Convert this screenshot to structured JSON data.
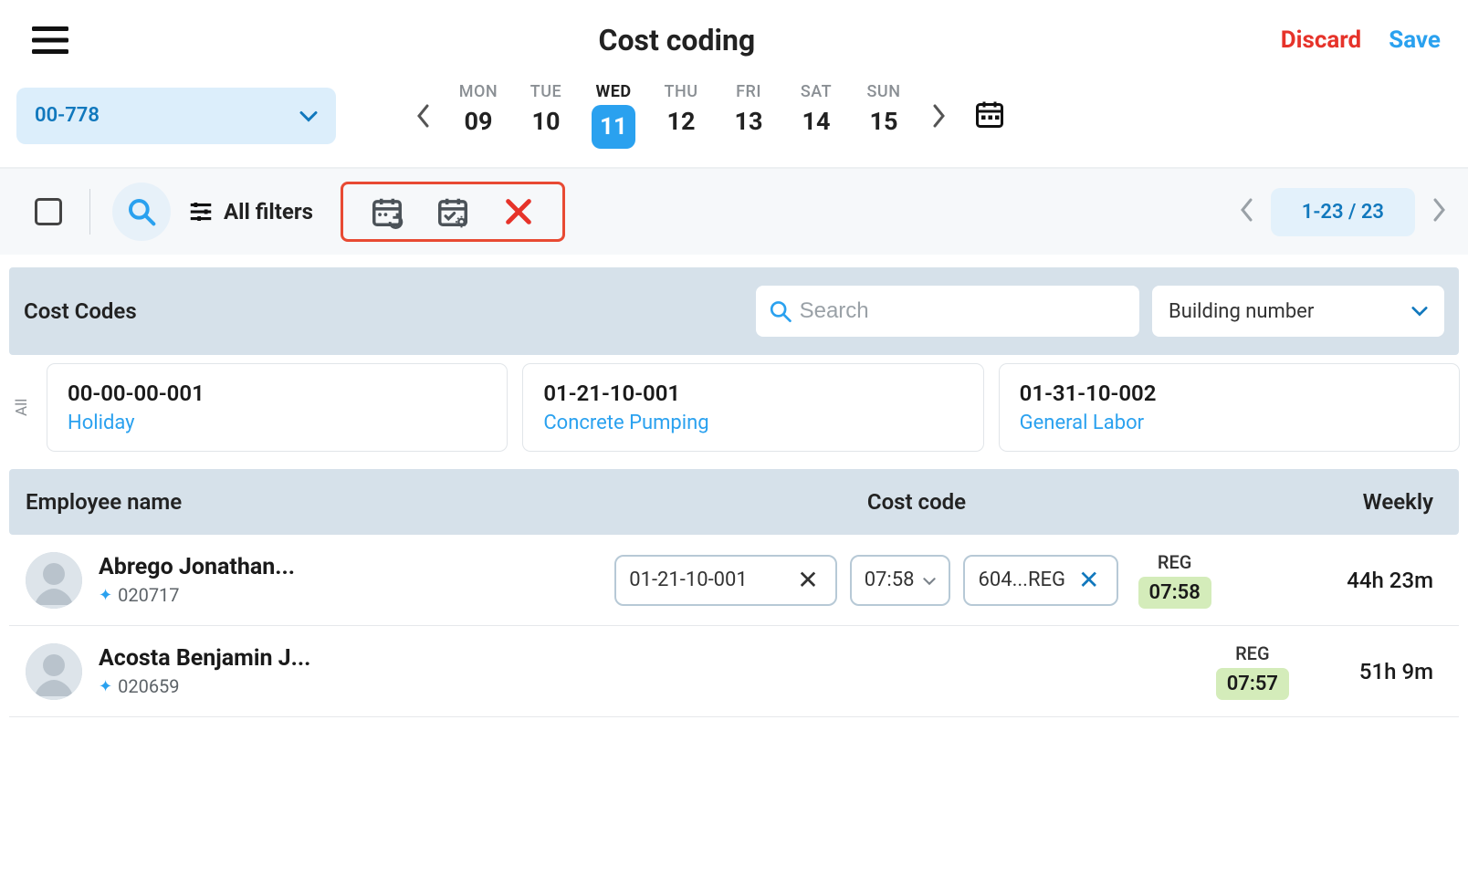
{
  "header": {
    "title": "Cost coding",
    "discard": "Discard",
    "save": "Save"
  },
  "project": {
    "code": "00-778"
  },
  "week": {
    "days": [
      {
        "label": "MON",
        "num": "09"
      },
      {
        "label": "TUE",
        "num": "10"
      },
      {
        "label": "WED",
        "num": "11",
        "selected": true
      },
      {
        "label": "THU",
        "num": "12"
      },
      {
        "label": "FRI",
        "num": "13"
      },
      {
        "label": "SAT",
        "num": "14"
      },
      {
        "label": "SUN",
        "num": "15"
      }
    ]
  },
  "toolbar": {
    "filters": "All filters",
    "pager_range": "1-23 / 23"
  },
  "cost_codes": {
    "title": "Cost Codes",
    "search_placeholder": "Search",
    "dropdown": "Building number",
    "all_label": "All",
    "items": [
      {
        "code": "00-00-00-001",
        "label": "Holiday"
      },
      {
        "code": "01-21-10-001",
        "label": "Concrete Pumping"
      },
      {
        "code": "01-31-10-002",
        "label": "General Labor"
      }
    ]
  },
  "table": {
    "headers": {
      "employee": "Employee name",
      "code": "Cost code",
      "weekly": "Weekly"
    },
    "rows": [
      {
        "name": "Abrego Jonathan...",
        "emp_id": "020717",
        "cc": "01-21-10-001",
        "time": "07:58",
        "alloc": "604...REG",
        "reg_label": "REG",
        "reg_time": "07:58",
        "weekly": "44h 23m"
      },
      {
        "name": "Acosta Benjamin J...",
        "emp_id": "020659",
        "reg_label": "REG",
        "reg_time": "07:57",
        "weekly": "51h 9m"
      }
    ]
  }
}
